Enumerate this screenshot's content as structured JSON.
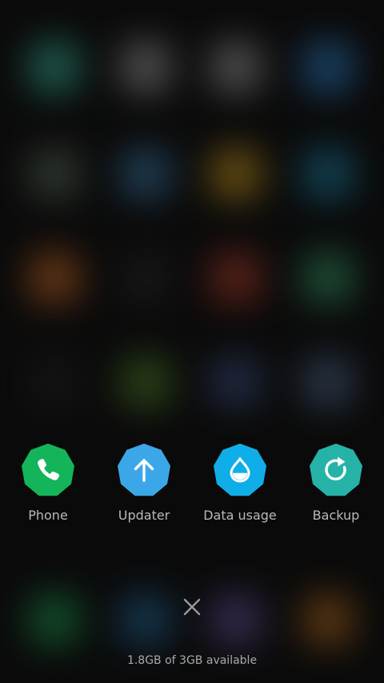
{
  "recent_apps": [
    {
      "label": "Phone",
      "icon": "phone-icon",
      "color": "#14b55a"
    },
    {
      "label": "Updater",
      "icon": "arrow-up-icon",
      "color": "#3ca7e8"
    },
    {
      "label": "Data usage",
      "icon": "water-drop-icon",
      "color": "#10aee8"
    },
    {
      "label": "Backup",
      "icon": "refresh-icon",
      "color": "#26b3a7"
    }
  ],
  "close_all_icon": "close-icon",
  "memory_status": "1.8GB of 3GB available",
  "colors": {
    "background": "#0f0f0f",
    "label_text": "#b9b9b9"
  }
}
